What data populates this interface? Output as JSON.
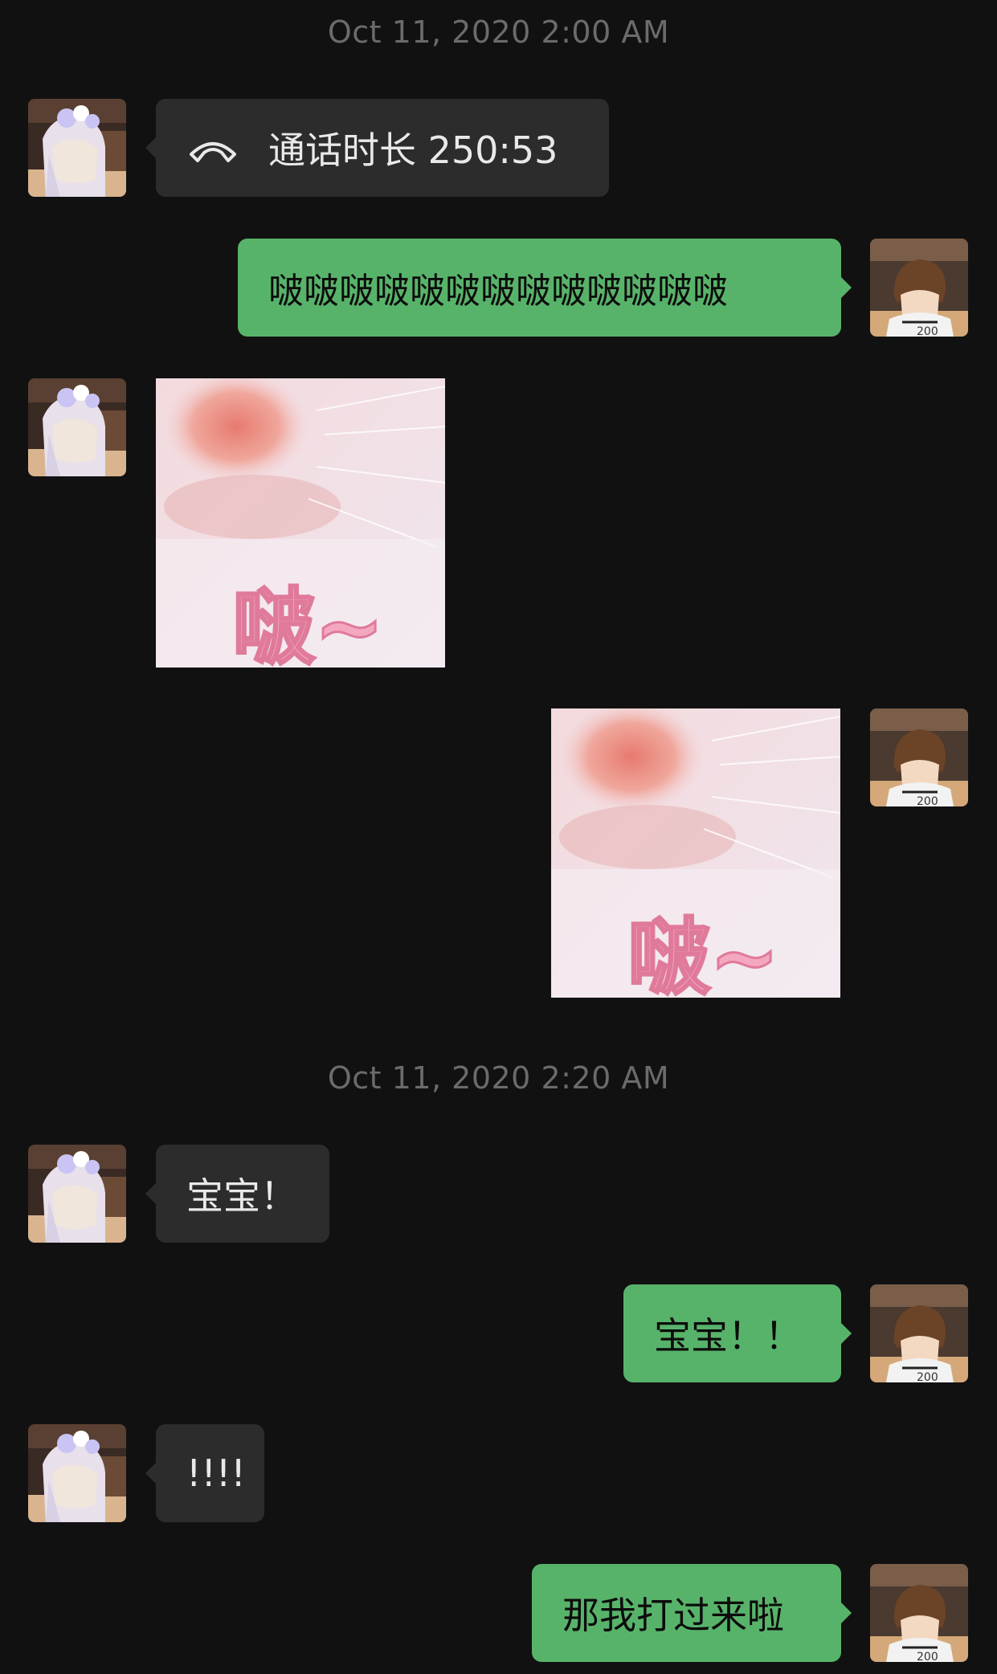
{
  "chat": {
    "timestamps": [
      "Oct 11, 2020 2:00 AM",
      "Oct 11, 2020 2:20 AM"
    ],
    "messages": [
      {
        "side": "left",
        "kind": "call",
        "icon": "phone-hangup-icon",
        "text": "通话时长 250:53"
      },
      {
        "side": "right",
        "kind": "text",
        "text": "啵啵啵啵啵啵啵啵啵啵啵啵啵"
      },
      {
        "side": "left",
        "kind": "sticker",
        "sticker_text": "啵~"
      },
      {
        "side": "right",
        "kind": "sticker",
        "sticker_text": "啵~"
      },
      {
        "side": "left",
        "kind": "text",
        "text": "宝宝！"
      },
      {
        "side": "right",
        "kind": "text",
        "text": "宝宝！！"
      },
      {
        "side": "left",
        "kind": "text",
        "text": "!!!!"
      },
      {
        "side": "right",
        "kind": "text",
        "text": "那我打过来啦"
      }
    ]
  },
  "colors": {
    "background": "#111111",
    "incoming_bubble": "#2c2c2c",
    "outgoing_bubble": "#58b36a",
    "timestamp": "#6b6b6b"
  }
}
